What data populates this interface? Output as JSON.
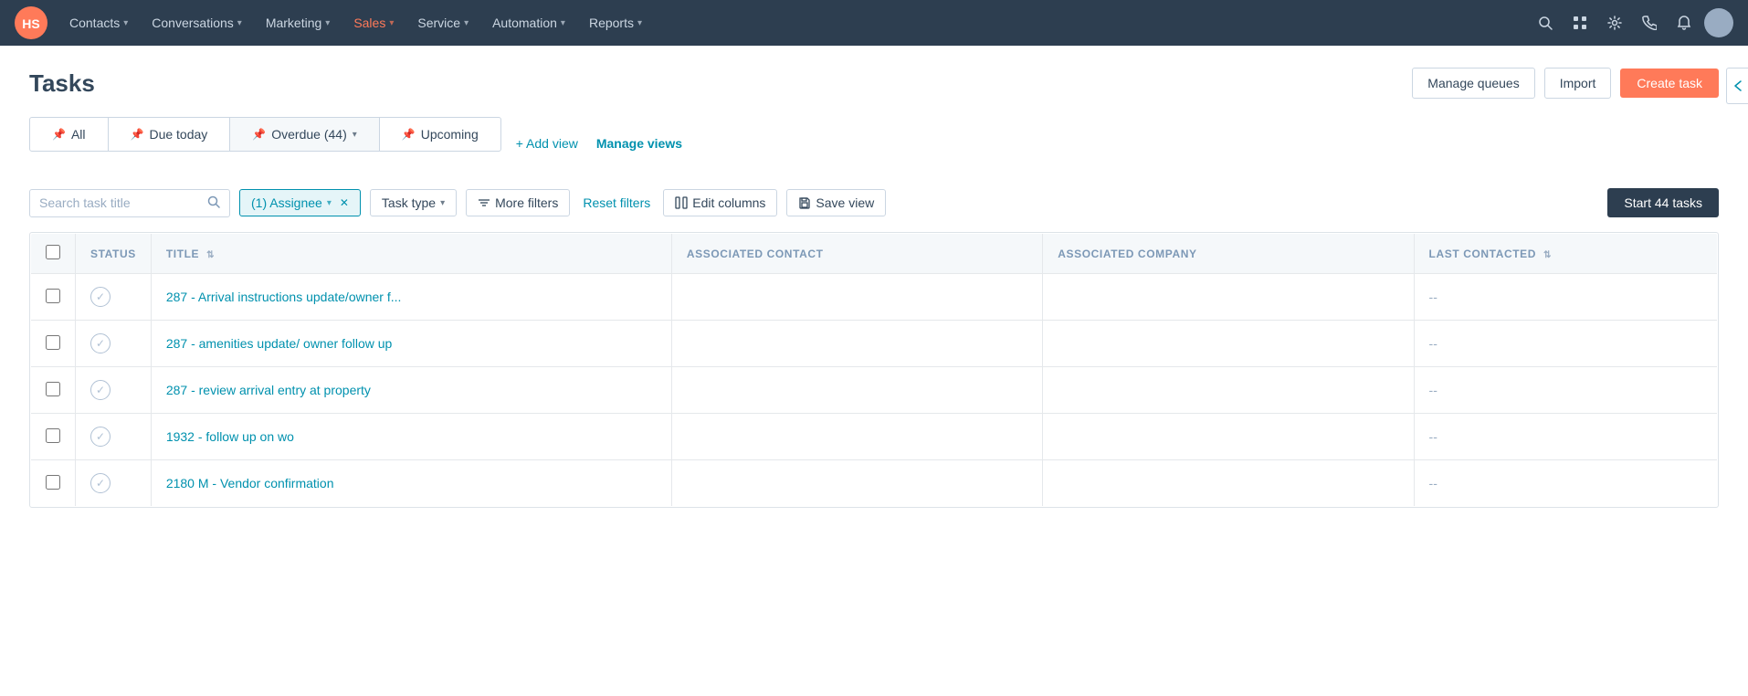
{
  "nav": {
    "logo_title": "HubSpot",
    "items": [
      {
        "label": "Contacts",
        "has_chevron": true
      },
      {
        "label": "Conversations",
        "has_chevron": true
      },
      {
        "label": "Marketing",
        "has_chevron": true
      },
      {
        "label": "Sales",
        "has_chevron": true,
        "active": true
      },
      {
        "label": "Service",
        "has_chevron": true
      },
      {
        "label": "Automation",
        "has_chevron": true
      },
      {
        "label": "Reports",
        "has_chevron": true
      }
    ]
  },
  "page": {
    "title": "Tasks",
    "manage_queues_label": "Manage queues",
    "import_label": "Import",
    "create_task_label": "Create task"
  },
  "tabs": [
    {
      "id": "all",
      "label": "All",
      "icon": "📌"
    },
    {
      "id": "due_today",
      "label": "Due today",
      "icon": "📌"
    },
    {
      "id": "overdue",
      "label": "Overdue (44)",
      "icon": "📌",
      "has_dropdown": true
    },
    {
      "id": "upcoming",
      "label": "Upcoming",
      "icon": "📌"
    }
  ],
  "tabs_extra": {
    "add_view_label": "+ Add view",
    "manage_views_label": "Manage views"
  },
  "filters": {
    "search_placeholder": "Search task title",
    "assignee_label": "(1) Assignee",
    "task_type_label": "Task type",
    "more_filters_label": "More filters",
    "reset_filters_label": "Reset filters",
    "edit_columns_label": "Edit columns",
    "save_view_label": "Save view",
    "start_tasks_label": "Start 44 tasks"
  },
  "table": {
    "columns": [
      {
        "id": "status",
        "label": "STATUS"
      },
      {
        "id": "title",
        "label": "TITLE",
        "sortable": true
      },
      {
        "id": "associated_contact",
        "label": "ASSOCIATED CONTACT"
      },
      {
        "id": "associated_company",
        "label": "ASSOCIATED COMPANY"
      },
      {
        "id": "last_contacted",
        "label": "LAST CONTACTED",
        "sortable": true
      }
    ],
    "rows": [
      {
        "status": "pending",
        "title": "287 - Arrival instructions update/owner f...",
        "associated_contact": "",
        "associated_company": "",
        "last_contacted": "--"
      },
      {
        "status": "pending",
        "title": "287 - amenities update/ owner follow up",
        "associated_contact": "",
        "associated_company": "",
        "last_contacted": "--"
      },
      {
        "status": "pending",
        "title": "287 - review arrival entry at property",
        "associated_contact": "",
        "associated_company": "",
        "last_contacted": "--"
      },
      {
        "status": "pending",
        "title": "1932 - follow up on wo",
        "associated_contact": "",
        "associated_company": "",
        "last_contacted": "--"
      },
      {
        "status": "pending",
        "title": "2180 M - Vendor confirmation",
        "associated_contact": "",
        "associated_company": "",
        "last_contacted": "--"
      }
    ]
  }
}
